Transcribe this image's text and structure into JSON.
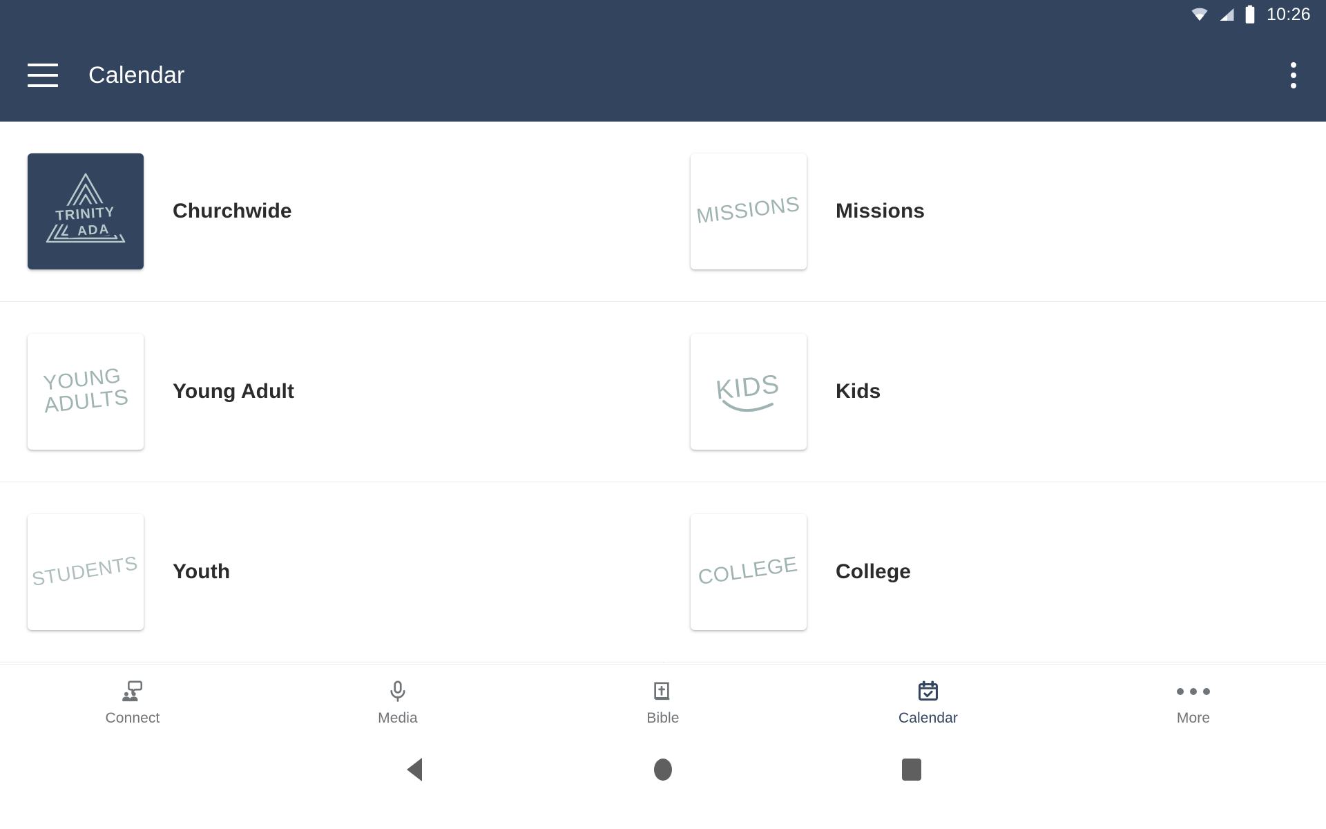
{
  "statusbar": {
    "time": "10:26",
    "icons": [
      "wifi-icon",
      "cellular-signal-icon",
      "battery-icon"
    ]
  },
  "appbar": {
    "menu_icon": "hamburger-menu-icon",
    "title": "Calendar",
    "overflow_icon": "overflow-menu-icon"
  },
  "colors": {
    "primary": "#33445f",
    "accent": "#33445f",
    "divider": "#ededed",
    "tab_inactive": "#6f7478",
    "thumb_art": "#9fb3b3",
    "label": "#2b2b2b",
    "surface": "#ffffff"
  },
  "main": {
    "categories": [
      {
        "label": "Churchwide",
        "thumb_text": "TRINITY ADA",
        "thumb_style": "logo",
        "icon": "trinity-ada-logo"
      },
      {
        "label": "Missions",
        "thumb_text": "MISSIONS",
        "thumb_style": "sketch",
        "icon": "missions-thumbnail"
      },
      {
        "label": "Young Adult",
        "thumb_text": "YOUNG ADULTS",
        "thumb_style": "sketch",
        "icon": "young-adults-thumbnail"
      },
      {
        "label": "Kids",
        "thumb_text": "KIDS",
        "thumb_style": "sketch",
        "icon": "kids-thumbnail"
      },
      {
        "label": "Youth",
        "thumb_text": "STUDENTS",
        "thumb_style": "sketch",
        "icon": "students-thumbnail"
      },
      {
        "label": "College",
        "thumb_text": "COLLEGE",
        "thumb_style": "sketch",
        "icon": "college-thumbnail"
      }
    ]
  },
  "tabbar": {
    "active": "Calendar",
    "tabs": [
      {
        "label": "Connect",
        "icon": "people-chat-icon",
        "active": false
      },
      {
        "label": "Media",
        "icon": "microphone-icon",
        "active": false
      },
      {
        "label": "Bible",
        "icon": "book-cross-icon",
        "active": false
      },
      {
        "label": "Calendar",
        "icon": "calendar-check-icon",
        "active": true
      },
      {
        "label": "More",
        "icon": "more-dots-icon",
        "active": false
      }
    ]
  },
  "sysnav": {
    "back": "back-button",
    "home": "home-button",
    "recents": "recents-button"
  }
}
